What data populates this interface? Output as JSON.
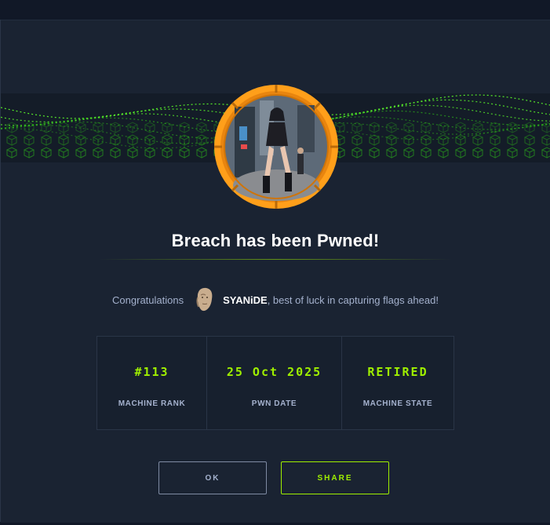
{
  "modal": {
    "title": "Breach has been Pwned!",
    "congrats_prefix": "Congratulations",
    "username": "SYANiDE",
    "congrats_suffix": ", best of luck in capturing flags ahead!",
    "avatar_icon": "machine-avatar",
    "user_avatar_icon": "user-avatar"
  },
  "stats": [
    {
      "value": "#113",
      "label": "MACHINE RANK"
    },
    {
      "value": "25 Oct 2025",
      "label": "PWN DATE"
    },
    {
      "value": "RETIRED",
      "label": "MACHINE STATE"
    }
  ],
  "buttons": {
    "ok_label": "OK",
    "share_label": "SHARE"
  },
  "colors": {
    "accent": "#9fef00",
    "ring": "#ff9f1a",
    "background": "#1a2332"
  }
}
